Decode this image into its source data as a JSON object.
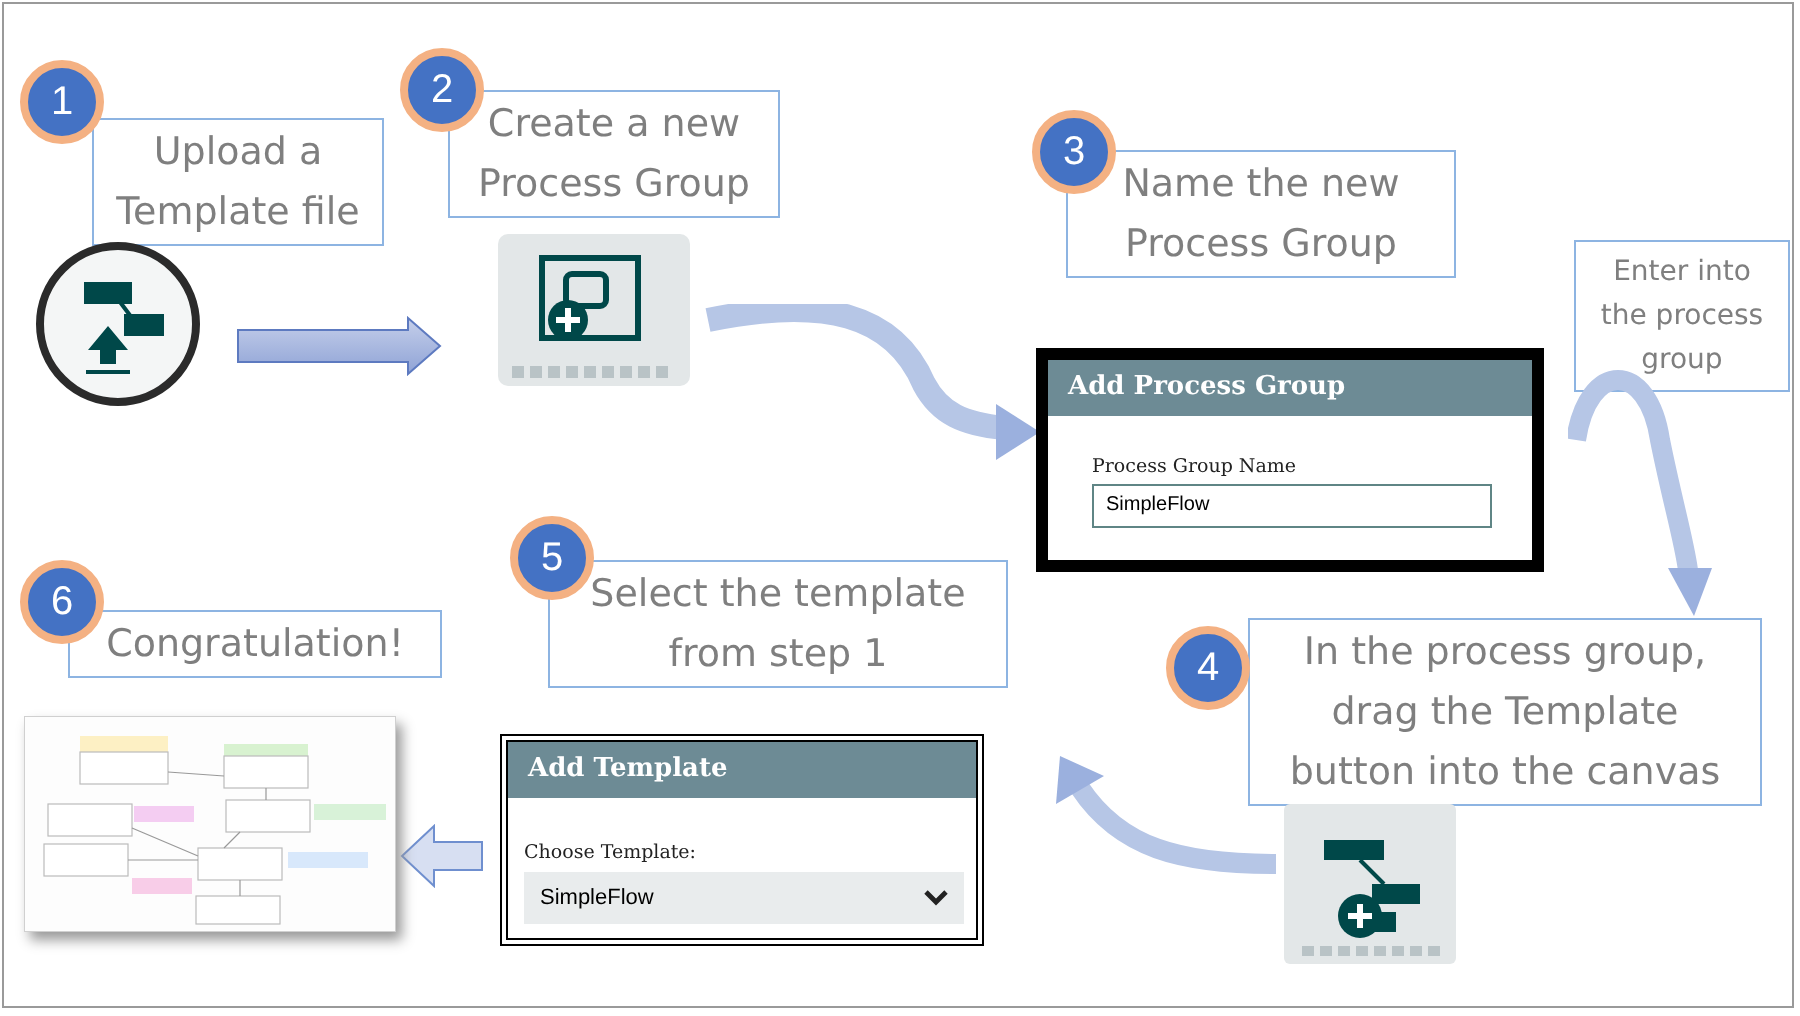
{
  "steps": [
    {
      "number": "1",
      "caption": "Upload a\nTemplate file",
      "kind": "large"
    },
    {
      "number": "2",
      "caption": "Create a new\nProcess Group",
      "kind": "large"
    },
    {
      "number": "3",
      "caption": "Name the new\nProcess Group",
      "kind": "large"
    },
    {
      "number": "6",
      "caption": "Congratulation!",
      "kind": "large"
    },
    {
      "number": "5",
      "caption": "Select the template\nfrom step 1",
      "kind": "large"
    },
    {
      "number": "4",
      "caption": "In the process group,\ndrag the Template\nbutton into the canvas",
      "kind": "large"
    }
  ],
  "note": "Enter into\nthe process\ngroup",
  "process_group_dialog": {
    "title": "Add Process Group",
    "label": "Process Group Name",
    "value": "SimpleFlow"
  },
  "template_dialog": {
    "title": "Add Template",
    "label": "Choose Template:",
    "value": "SimpleFlow"
  }
}
